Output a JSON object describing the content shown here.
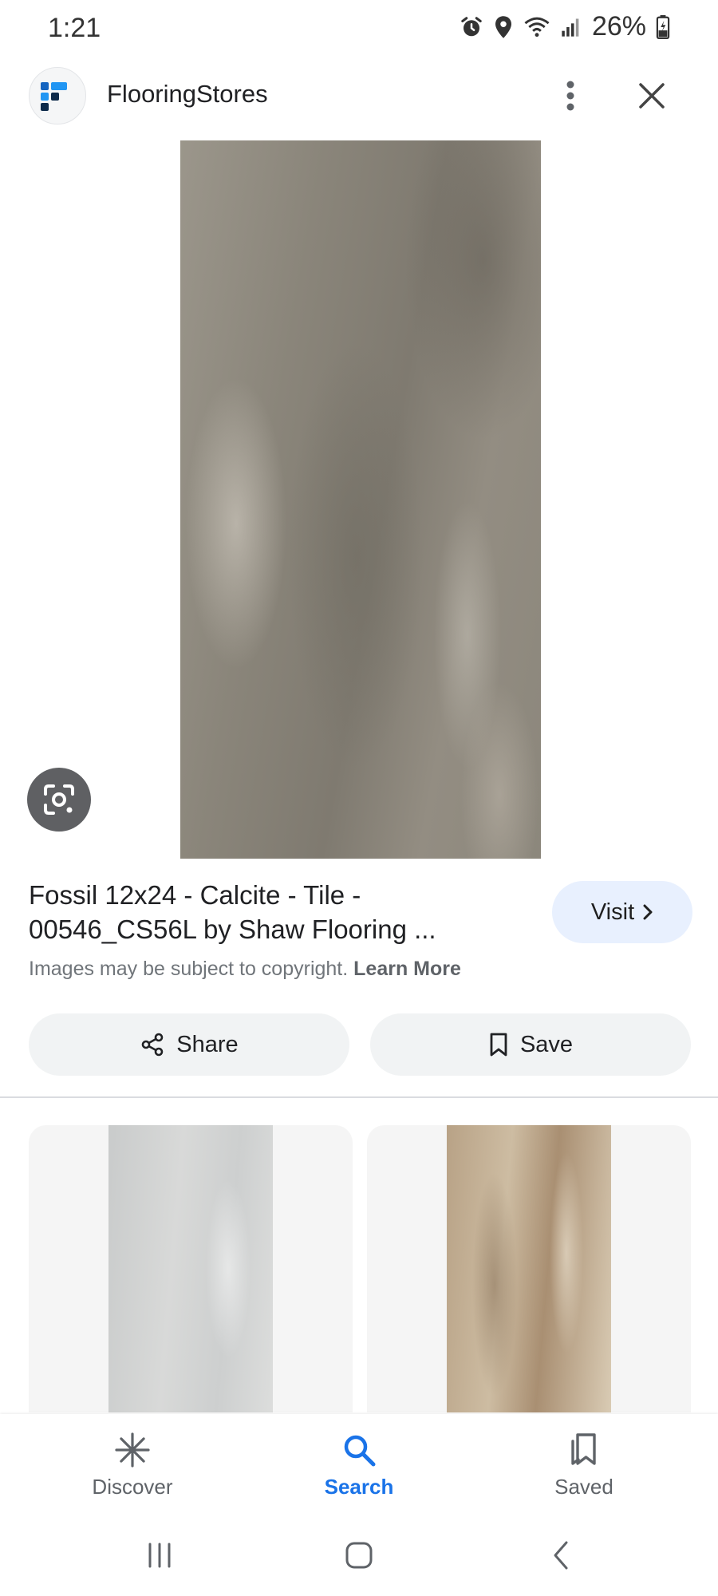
{
  "status_bar": {
    "time": "1:21",
    "battery": "26%",
    "icons": [
      "alarm-icon",
      "location-icon",
      "wifi-icon",
      "signal-icon",
      "battery-icon"
    ]
  },
  "header": {
    "site_name": "FlooringStores",
    "logo_icon": "flooringstores-logo",
    "menu_icon": "more-vert-icon",
    "close_icon": "close-icon"
  },
  "result": {
    "title": "Fossil 12x24 - Calcite - Tile - 00546_CS56L by Shaw Flooring ...",
    "visit_label": "Visit",
    "copyright_text": "Images may be subject to copyright.",
    "learn_more": "Learn More",
    "lens_icon": "google-lens-icon"
  },
  "actions": {
    "share_label": "Share",
    "save_label": "Save"
  },
  "bottom_nav": {
    "items": [
      {
        "label": "Discover",
        "icon": "asterisk-icon"
      },
      {
        "label": "Search",
        "icon": "search-icon",
        "active": true
      },
      {
        "label": "Saved",
        "icon": "saved-icon"
      }
    ]
  },
  "colors": {
    "accent": "#1a73e8",
    "visit_bg": "#e8f0fe",
    "button_bg": "#f1f3f4"
  }
}
